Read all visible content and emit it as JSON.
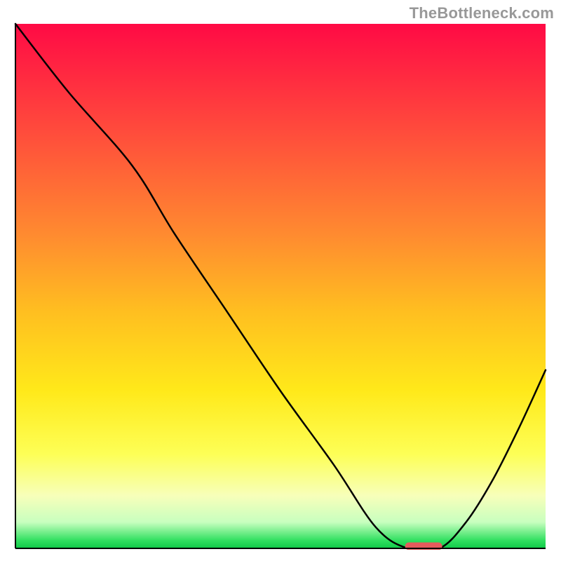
{
  "watermark": "TheBottleneck.com",
  "chart_data": {
    "type": "line",
    "title": "",
    "xlabel": "",
    "ylabel": "",
    "xlim": [
      0,
      100
    ],
    "ylim": [
      0,
      100
    ],
    "grid": false,
    "legend": false,
    "annotations": [],
    "curve": {
      "name": "bottleneck-curve",
      "x": [
        0,
        10,
        22,
        30,
        40,
        50,
        60,
        68,
        74,
        80,
        85,
        90,
        95,
        100
      ],
      "y": [
        100,
        87,
        73,
        60,
        45,
        30,
        16,
        4,
        0,
        0,
        5,
        13,
        23,
        34
      ]
    },
    "sweet_spot_marker": {
      "x_center": 77,
      "y": 0.4,
      "width": 7,
      "color": "#e55b5c"
    },
    "gradient_stops": [
      {
        "offset": 0.0,
        "color": "#ff0a45"
      },
      {
        "offset": 0.2,
        "color": "#ff4a3c"
      },
      {
        "offset": 0.4,
        "color": "#ff8a30"
      },
      {
        "offset": 0.55,
        "color": "#ffbf20"
      },
      {
        "offset": 0.7,
        "color": "#ffe91a"
      },
      {
        "offset": 0.82,
        "color": "#fdff56"
      },
      {
        "offset": 0.9,
        "color": "#f7ffba"
      },
      {
        "offset": 0.95,
        "color": "#c8ffbf"
      },
      {
        "offset": 0.985,
        "color": "#30e060"
      },
      {
        "offset": 1.0,
        "color": "#10c848"
      }
    ],
    "axis": {
      "stroke": "#000000",
      "width": 2
    }
  }
}
